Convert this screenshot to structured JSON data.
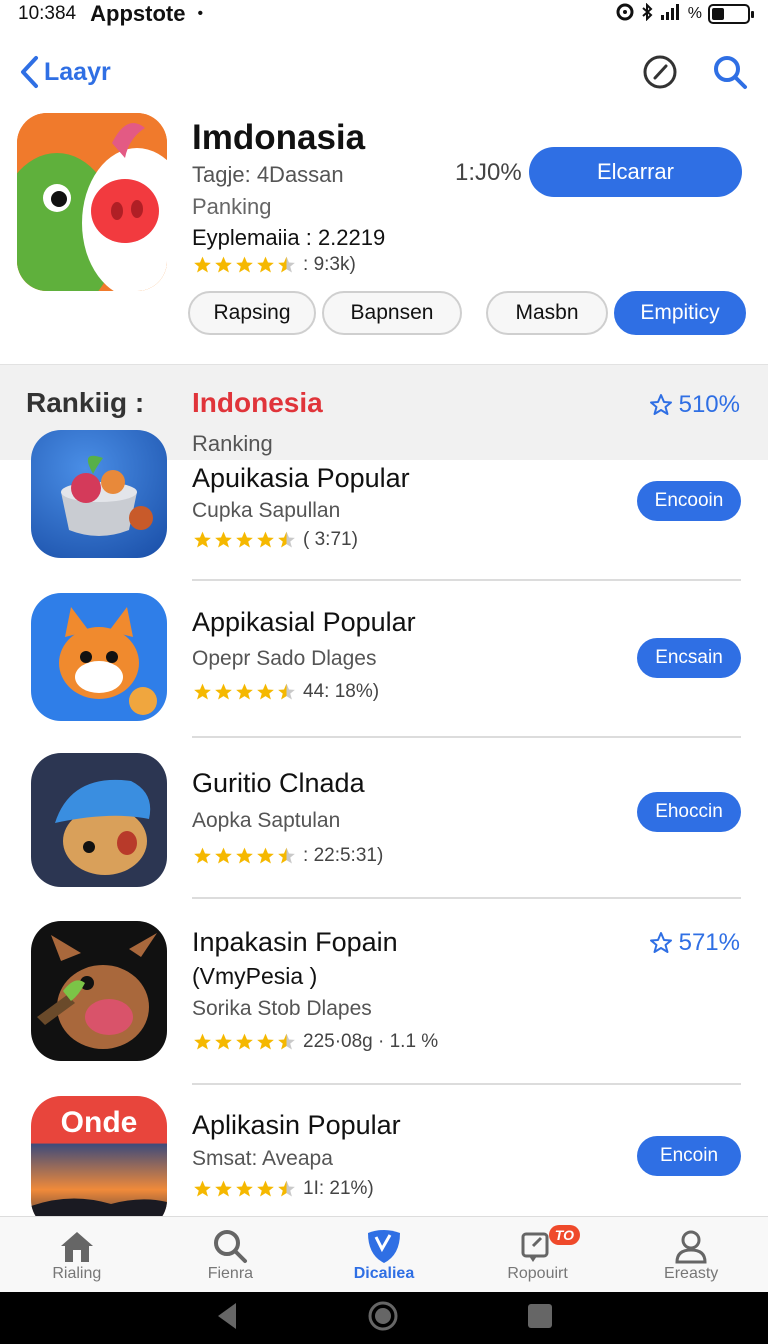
{
  "status": {
    "time": "10:384",
    "app_name": "Appstote",
    "dot": "•",
    "battery_text": "%"
  },
  "nav": {
    "back_label": "Laayr"
  },
  "hero": {
    "title": "Imdonasia",
    "line1": "Tagje: 4Dassan",
    "line2": "Panking",
    "meta": "Eyplemaiia : 2.2219",
    "rating_text": "9:3k)",
    "percent": "1:J0%",
    "button_label": "Elcarrar",
    "chips": [
      {
        "label": "Rapsing",
        "active": false
      },
      {
        "label": "Bapnsen",
        "active": false
      },
      {
        "label": "Masbn",
        "active": false
      },
      {
        "label": "Empiticy",
        "active": true
      }
    ]
  },
  "ranking": {
    "label": "Rankiig :",
    "country": "Indonesia",
    "sub": "Ranking",
    "percent": "510%"
  },
  "apps": [
    {
      "title": "Apuikasia Popular",
      "subtitle": "Cupka Sapullan",
      "rating_text": "( 3:71)",
      "button": "Encooin"
    },
    {
      "title": "Appikasial Popular",
      "subtitle": "Opepr Sado Dlages",
      "rating_text": "44: 18%)",
      "button": "Encsain"
    },
    {
      "title": "Guritio Clnada",
      "subtitle": "Aopka Saptulan",
      "rating_text": "22:5:31)",
      "button": "Ehoccin"
    },
    {
      "title": "Inpakasin Fopain",
      "title2": "(VmyPesia )",
      "subtitle": "Sorika Stob Dlapes",
      "rating_text": "225·08g · 1.1 %",
      "percent": "571%"
    },
    {
      "title": "Aplikasin Popular",
      "subtitle": "Smsat: Aveapa",
      "rating_text": "1I: 21%)",
      "button": "Encoin",
      "icon_text": "Onde"
    }
  ],
  "tabs": [
    {
      "label": "Rialing",
      "icon": "home-icon"
    },
    {
      "label": "Fienra",
      "icon": "search-icon"
    },
    {
      "label": "Dicaliea",
      "icon": "discover-icon",
      "active": true
    },
    {
      "label": "Ropouirt",
      "icon": "updates-icon",
      "badge": "TO"
    },
    {
      "label": "Ereasty",
      "icon": "person-icon"
    }
  ],
  "colors": {
    "accent": "#2f6fe4",
    "country_red": "#e0343a",
    "star": "#f5b800"
  }
}
